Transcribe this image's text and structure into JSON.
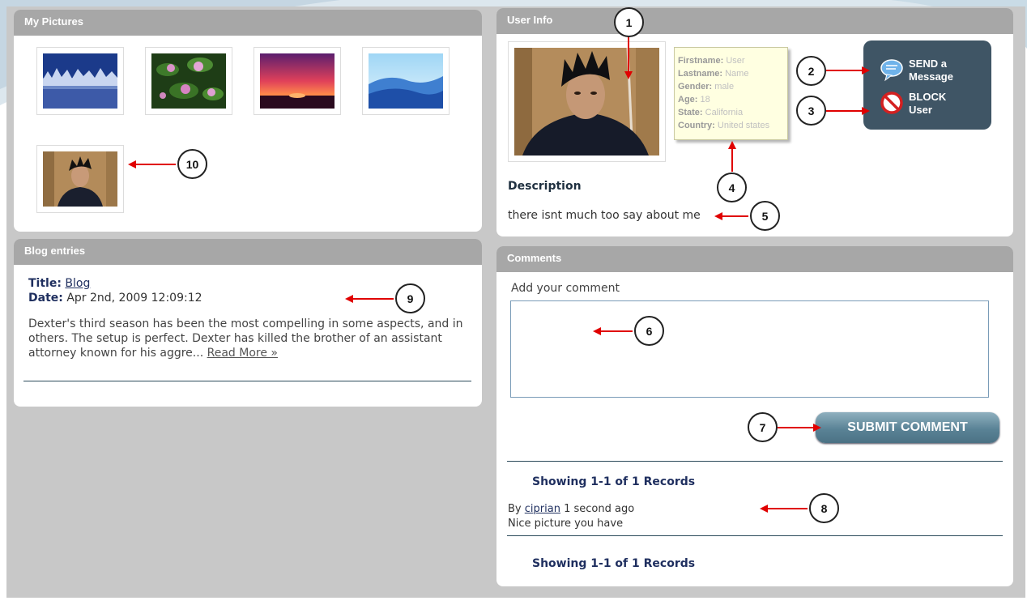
{
  "pictures": {
    "title": "My Pictures",
    "items": [
      {
        "name": "winter-forest-thumb"
      },
      {
        "name": "water-lilies-thumb"
      },
      {
        "name": "sunset-thumb"
      },
      {
        "name": "blue-hills-thumb"
      },
      {
        "name": "user-photo-thumb"
      }
    ]
  },
  "blog": {
    "title": "Blog entries",
    "title_label": "Title:",
    "title_value": "Blog",
    "date_label": "Date:",
    "date_value": "Apr 2nd, 2009 12:09:12",
    "excerpt": "Dexter's third season has been the most compelling in some aspects, and in others. The setup is perfect. Dexter has killed the brother of an assistant attorney known for his aggre...",
    "read_more": "Read More »"
  },
  "user_info": {
    "title": "User Info",
    "tooltip": {
      "firstname_label": "Firstname:",
      "firstname": "User",
      "lastname_label": "Lastname:",
      "lastname": "Name",
      "gender_label": "Gender:",
      "gender": "male",
      "age_label": "Age:",
      "age": "18",
      "state_label": "State:",
      "state": "California",
      "country_label": "Country:",
      "country": "United states"
    },
    "send_line1": "SEND a",
    "send_line2": "Message",
    "block_line1": "BLOCK",
    "block_line2": "User",
    "description_title": "Description",
    "description_text": "there isnt much too say about me"
  },
  "comments": {
    "title": "Comments",
    "add_label": "Add your comment",
    "submit_label": "SUBMIT COMMENT",
    "records_top": "Showing 1-1 of 1 Records",
    "by_label": "By",
    "author": "ciprian",
    "time": "1 second ago",
    "text": "Nice picture you have",
    "records_bottom": "Showing 1-1 of 1 Records"
  },
  "callouts": [
    "1",
    "2",
    "3",
    "4",
    "5",
    "6",
    "7",
    "8",
    "9",
    "10"
  ],
  "colors": {
    "header": "#a7a7a7",
    "arrow": "#e00000",
    "action_box": "#3f5565"
  }
}
